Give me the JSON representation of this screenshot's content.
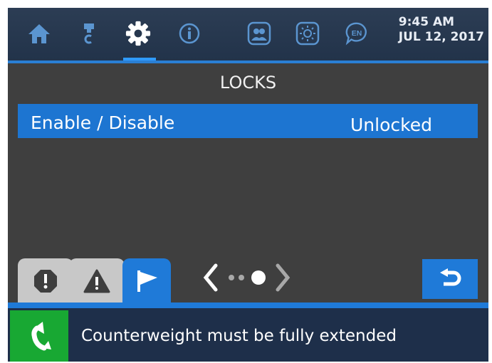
{
  "nav": {
    "items": [
      {
        "name": "home",
        "icon": "home-icon"
      },
      {
        "name": "tool",
        "icon": "tool-icon"
      },
      {
        "name": "settings",
        "icon": "gear-icon",
        "active": true
      },
      {
        "name": "info",
        "icon": "info-icon"
      },
      {
        "name": "operators",
        "icon": "users-icon"
      },
      {
        "name": "brightness",
        "icon": "brightness-icon"
      },
      {
        "name": "language",
        "icon": "language-icon",
        "label": "EN"
      }
    ],
    "time": "9:45 AM",
    "date": "JUL 12, 2017"
  },
  "page": {
    "title": "LOCKS",
    "rows": [
      {
        "label": "Enable / Disable",
        "value": "Unlocked"
      }
    ]
  },
  "tabs": [
    {
      "icon": "alert-octagon-icon",
      "active": false
    },
    {
      "icon": "warning-triangle-icon",
      "active": false
    },
    {
      "icon": "flag-icon",
      "active": true
    }
  ],
  "pager": {
    "pages": 3,
    "current": 3
  },
  "status": {
    "icon": "turn-arrow-icon",
    "message": "Counterweight must be fully extended"
  },
  "colors": {
    "accent_blue": "#1f7ad8",
    "status_green": "#18a833",
    "background": "#3f3f3f",
    "topbar": "#22334a"
  }
}
